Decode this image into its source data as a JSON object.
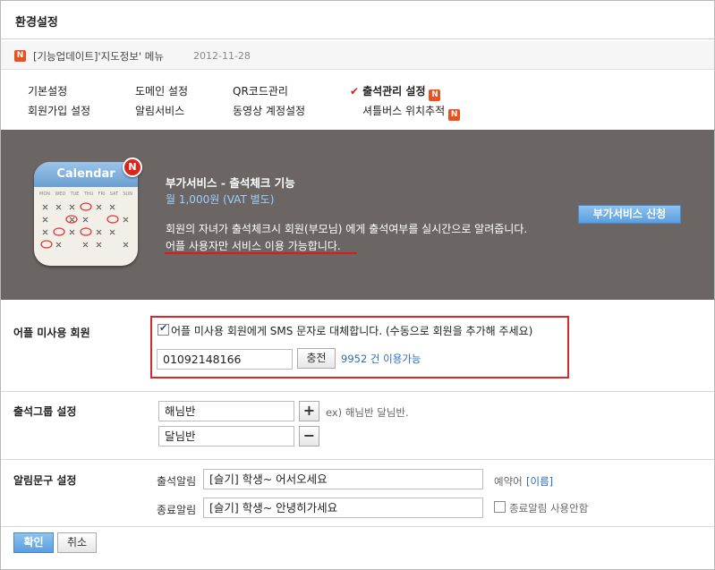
{
  "page": {
    "title": "환경설정"
  },
  "notice": {
    "badge": "N",
    "text": "[기능업데이트]'지도정보' 메뉴",
    "date": "2012-11-28"
  },
  "tabs": [
    {
      "label": "기본설정"
    },
    {
      "label": "도메인 설정"
    },
    {
      "label": "QR코드관리"
    },
    {
      "label": "출석관리 설정",
      "active": true,
      "check": "✔",
      "badge": "N"
    },
    {
      "label": "회원가입 설정"
    },
    {
      "label": "알림서비스"
    },
    {
      "label": "동영상 계정설정"
    },
    {
      "label": "셔틀버스 위치추적",
      "badge": "N"
    }
  ],
  "banner": {
    "icon_title": "Calendar",
    "icon_badge": "N",
    "icon_days": [
      "MON",
      "WED",
      "TUE",
      "THU",
      "FRI",
      "SAT",
      "SUN"
    ],
    "title": "부가서비스 - 출석체크 기능",
    "price": "월 1,000원 (VAT 별도)",
    "desc1": "회원의 자녀가 출석체크시 회원(부모님) 에게 출석여부를 실시간으로 알려줍니다.",
    "desc2": "어플 사용자만 서비스 이용 가능합니다.",
    "apply_button": "부가서비스 신청",
    "accent": "#e01818"
  },
  "non_app": {
    "label": "어플 미사용 회원",
    "sms_checked": true,
    "sms_text": "어플 미사용 회원에게 SMS 문자로 대체합니다. (수동으로 회원을 추가해 주세요)",
    "phone": "01092148166",
    "charge_button": "충전",
    "available": "9952 건 이용가능"
  },
  "group": {
    "label": "출석그룹 설정",
    "groups": [
      "해님반",
      "달님반"
    ],
    "add_button": "+",
    "remove_button": "−",
    "example": "ex) 해님반 달님반."
  },
  "message": {
    "label": "알림문구 설정",
    "arrive_label": "출석알림",
    "arrive_value": "[슬기] 학생~ 어서오세요",
    "reserved_word": "예약어",
    "reserved_link": "[이름]",
    "leave_label": "종료알림",
    "leave_value": "[슬기] 학생~ 안녕히가세요",
    "leave_disable_checked": false,
    "leave_disable_label": "종료알림 사용안함"
  },
  "actions": {
    "ok": "확인",
    "cancel": "취소"
  }
}
